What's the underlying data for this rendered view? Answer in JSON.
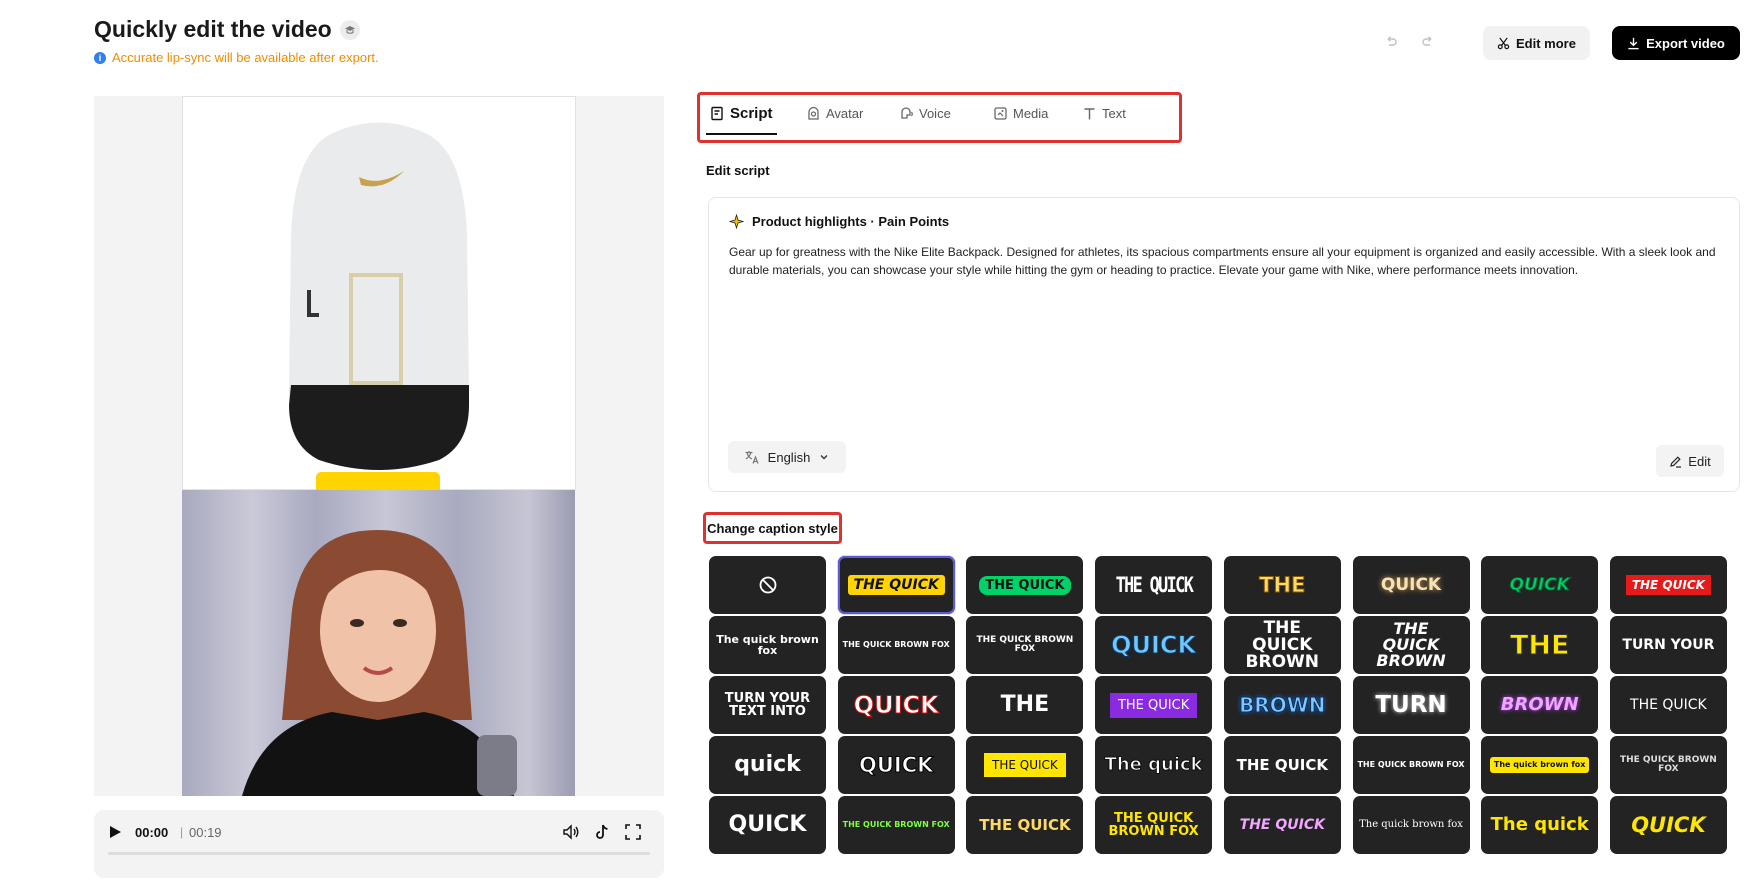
{
  "header": {
    "title": "Quickly edit the video",
    "notice": "Accurate lip-sync will be available after export.",
    "edit_more_label": "Edit more",
    "export_label": "Export video"
  },
  "player": {
    "current_time": "00:00",
    "separator": "|",
    "total_time": "00:19",
    "progress": 0
  },
  "tabs": [
    {
      "label": "Script",
      "active": true
    },
    {
      "label": "Avatar",
      "active": false
    },
    {
      "label": "Voice",
      "active": false
    },
    {
      "label": "Media",
      "active": false
    },
    {
      "label": "Text",
      "active": false
    }
  ],
  "script": {
    "section_label": "Edit script",
    "heading": "Product highlights · Pain Points",
    "text": "Gear up for greatness with the Nike Elite Backpack. Designed for athletes, its spacious compartments ensure all your equipment is organized and easily accessible. With a sleek look and durable materials, you can showcase your style while hitting the gym or heading to practice. Elevate your game with Nike, where performance meets innovation.",
    "language": "English",
    "edit_label": "Edit"
  },
  "caption_styles": {
    "title": "Change caption style",
    "rows": [
      [
        "",
        "THE QUICK",
        "THE QUICK",
        "THE QUICK",
        "THE",
        "QUICK",
        "QUICK",
        "THE QUICK"
      ],
      [
        "The quick brown fox",
        "THE QUICK BROWN FOX",
        "THE QUICK BROWN FOX",
        "QUICK",
        "THE QUICK BROWN",
        "THE QUICK BROWN",
        "THE",
        "TURN YOUR"
      ],
      [
        "TURN YOUR TEXT INTO",
        "QUICK",
        "THE",
        "THE QUICK",
        "BROWN",
        "TURN",
        "BROWN",
        "THE QUICK"
      ],
      [
        "quick",
        "QUICK",
        "THE QUICK",
        "The quick",
        "THE QUICK",
        "THE QUICK BROWN FOX",
        "The quick brown fox",
        "THE QUICK BROWN FOX"
      ],
      [
        "QUICK",
        "THE QUICK BROWN FOX",
        "THE QUICK",
        "THE QUICK BROWN FOX",
        "THE QUICK",
        "The quick brown fox",
        "The quick",
        "QUICK"
      ]
    ],
    "selected": [
      0,
      1
    ]
  },
  "colors": {
    "accent_red": "#e03131",
    "notice_orange": "#f08c00",
    "caption_yellow": "#ffd400",
    "caption_green": "#00d26a"
  }
}
